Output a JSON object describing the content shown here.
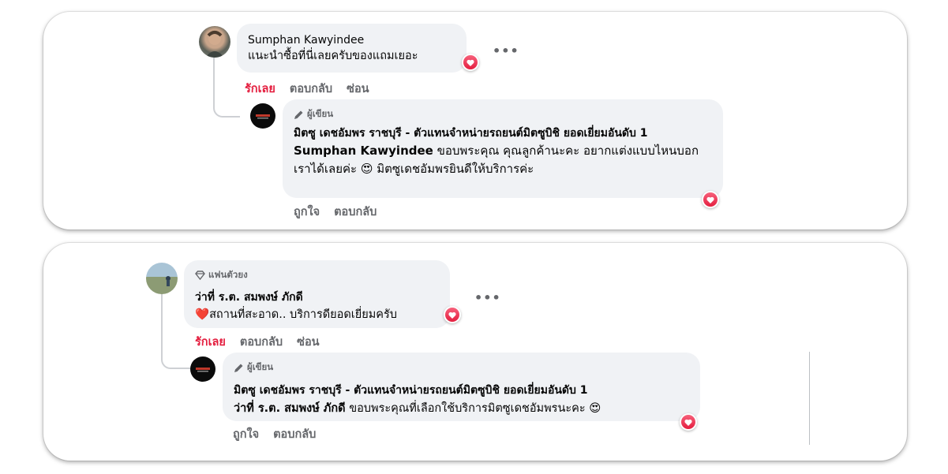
{
  "comment1": {
    "author": "Sumphan Kawyindee",
    "text": "แนะนำซื้อที่นี่เลยครับของแถมเยอะ",
    "actions": [
      "รักเลย",
      "ตอบกลับ",
      "ซ่อน"
    ],
    "more": "•••",
    "reply": {
      "badge": "ผู้เขียน",
      "author": "มิตซู เดชอัมพร ราชบุรี - ตัวแทนจำหน่ายรถยนต์มิตซูบิชิ ยอดเยี่ยมอันดับ 1",
      "mention": "Sumphan Kawyindee",
      "text_a": "ขอบพระคุณ คุณลูกค้านะคะ อยากแต่งแบบไหนบอกเราได้เลยค่ะ",
      "emoji": "😍",
      "text_b": "มิตซูเดชอัมพรยินดีให้บริการค่ะ",
      "actions": [
        "ถูกใจ",
        "ตอบกลับ"
      ]
    }
  },
  "comment2": {
    "badge": "แฟนตัวยง",
    "author": "ว่าที่ ร.ต. สมพงษ์ ภักดี",
    "heart_emoji": "❤️",
    "text": "สถานที่สะอาด.. บริการดียอดเยี่ยมครับ",
    "actions": [
      "รักเลย",
      "ตอบกลับ",
      "ซ่อน"
    ],
    "more": "•••",
    "reply": {
      "badge": "ผู้เขียน",
      "author": "มิตซู เดชอัมพร ราชบุรี - ตัวแทนจำหน่ายรถยนต์มิตซูบิชิ ยอดเยี่ยมอันดับ 1",
      "mention": "ว่าที่ ร.ต. สมพงษ์ ภักดี",
      "text": "ขอบพระคุณที่เลือกใช้บริการมิตซูเดชอัมพรนะคะ",
      "emoji": "😍",
      "actions": [
        "ถูกใจ",
        "ตอบกลับ"
      ]
    }
  },
  "icons": {
    "author_badge": "pencil-icon",
    "fan_badge": "diamond-icon",
    "reaction": "heart-reaction-icon"
  },
  "colors": {
    "bubble": "#f0f2f5",
    "love_red": "#e41e3f",
    "secondary_text": "#65676b"
  }
}
